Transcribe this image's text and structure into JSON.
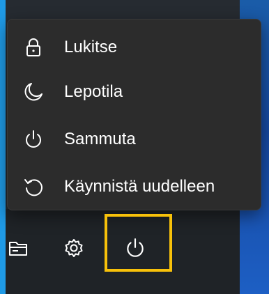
{
  "power_menu": {
    "items": [
      {
        "label": "Lukitse",
        "icon": "lock-icon"
      },
      {
        "label": "Lepotila",
        "icon": "moon-icon"
      },
      {
        "label": "Sammuta",
        "icon": "power-icon"
      },
      {
        "label": "Käynnistä uudelleen",
        "icon": "restart-icon"
      }
    ]
  },
  "footer": {
    "buttons": [
      {
        "icon": "file-explorer-icon"
      },
      {
        "icon": "settings-gear-icon"
      },
      {
        "icon": "power-icon"
      }
    ]
  },
  "colors": {
    "menu_background": "#2c2c2c",
    "text": "#ffffff",
    "highlight": "#f7c10a",
    "desktop": "#1f9ae6"
  }
}
